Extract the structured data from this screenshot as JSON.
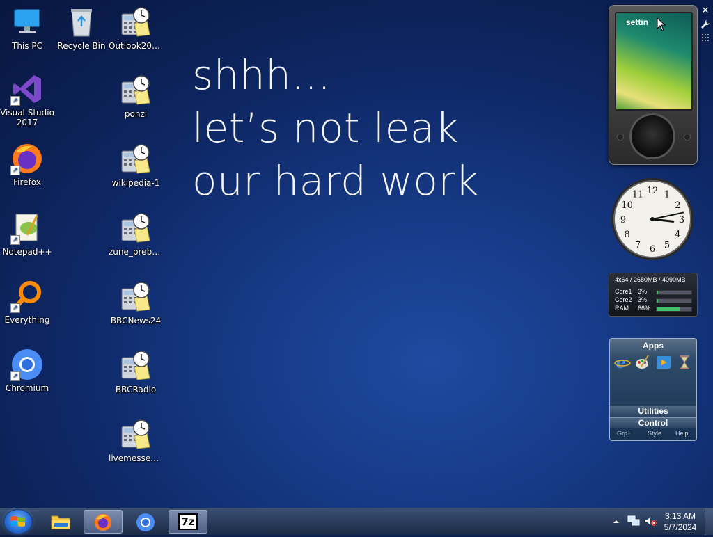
{
  "desktop": {
    "icons": [
      {
        "label": "This PC",
        "icon": "computer-icon"
      },
      {
        "label": "Recycle Bin",
        "icon": "recycle-bin-icon"
      },
      {
        "label": "Outlook200...",
        "icon": "calculator-clock-icon"
      },
      {
        "label": "Visual Studio 2017",
        "icon": "visual-studio-icon"
      },
      {
        "label": "ponzi",
        "icon": "calculator-clock-icon"
      },
      {
        "label": "Firefox",
        "icon": "firefox-icon"
      },
      {
        "label": "wikipedia-1",
        "icon": "calculator-clock-icon"
      },
      {
        "label": "Notepad++",
        "icon": "notepadpp-icon"
      },
      {
        "label": "zune_prebui...",
        "icon": "calculator-clock-icon"
      },
      {
        "label": "Everything",
        "icon": "everything-search-icon"
      },
      {
        "label": "BBCNews24",
        "icon": "calculator-clock-icon"
      },
      {
        "label": "Chromium",
        "icon": "chromium-icon"
      },
      {
        "label": "BBCRadio",
        "icon": "calculator-clock-icon"
      },
      {
        "label": "livemessen...",
        "icon": "calculator-clock-icon"
      }
    ]
  },
  "wallpaper": {
    "lines": [
      "shhh...",
      "let’s not leak",
      "our hard work"
    ]
  },
  "gadgets": {
    "zune": {
      "screen_text": "settin"
    },
    "clock": {
      "hour": 3,
      "minute": 13,
      "numerals": [
        "12",
        "1",
        "2",
        "3",
        "4",
        "5",
        "6",
        "7",
        "8",
        "9",
        "10",
        "11"
      ]
    },
    "cpu": {
      "header": "4x64 / 2680MB / 4090MB",
      "rows": [
        {
          "name": "Core1",
          "value": "3%",
          "level": 0.03
        },
        {
          "name": "Core2",
          "value": "3%",
          "level": 0.03
        },
        {
          "name": "RAM",
          "value": "66%",
          "level": 0.66
        }
      ]
    },
    "apps": {
      "title": "Apps",
      "sections": [
        "Utilities",
        "Control"
      ],
      "footer": [
        "Grp+",
        "Style",
        "Help"
      ]
    }
  },
  "taskbar": {
    "items": [
      "start-orb",
      "file-explorer",
      "firefox",
      "chromium",
      "7zip"
    ],
    "sevenzip_label": "7z",
    "time": "3:13 AM",
    "date": "5/7/2024"
  },
  "colors": {
    "accent": "#44c06a",
    "taskbar": "#1b2b47"
  }
}
